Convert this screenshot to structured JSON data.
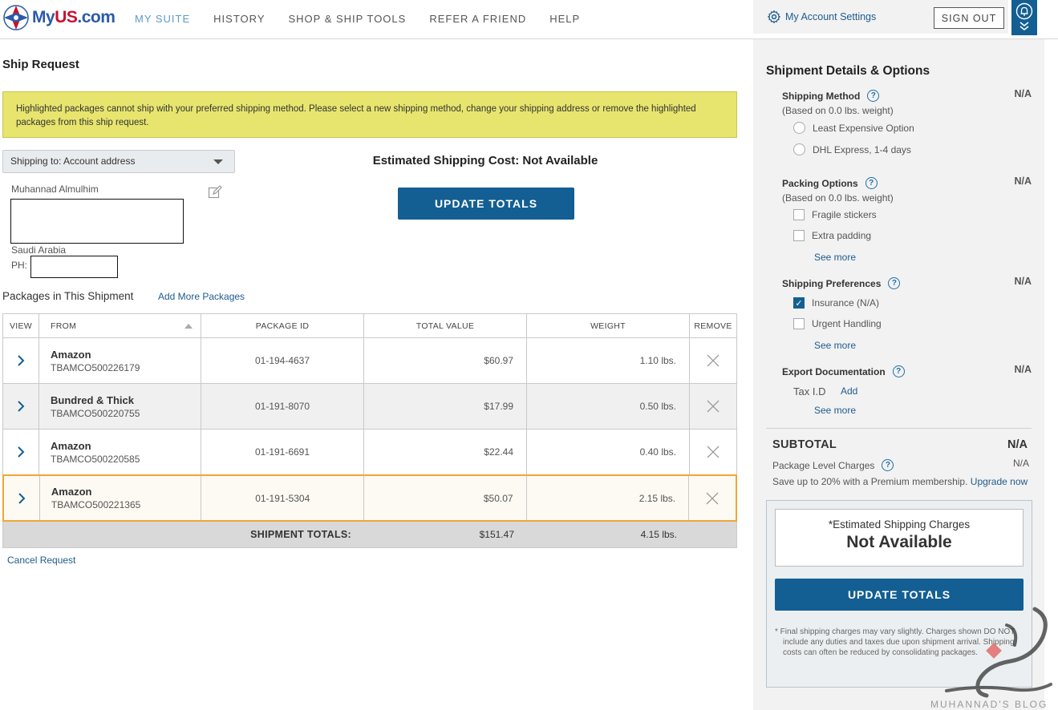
{
  "header": {
    "logo": {
      "part1": "My",
      "part2": "US",
      "part3": ".com"
    },
    "nav": [
      {
        "label": "MY SUITE",
        "active": true
      },
      {
        "label": "HISTORY",
        "active": false
      },
      {
        "label": "SHOP & SHIP TOOLS",
        "active": false
      },
      {
        "label": "REFER A FRIEND",
        "active": false
      },
      {
        "label": "HELP",
        "active": false
      }
    ],
    "account_settings": "My Account Settings",
    "sign_out": "SIGN OUT"
  },
  "main": {
    "title": "Ship Request",
    "alert": "Highlighted packages cannot ship with your preferred shipping method. Please select a new shipping method, change your shipping address or remove the highlighted packages from this ship request.",
    "shipping_to": "Shipping to: Account address",
    "address": {
      "name": "Muhannad Almulhim",
      "country": "Saudi Arabia",
      "phone_label": "PH:"
    },
    "estimated_cost": "Estimated Shipping Cost: Not Available",
    "update_totals": "UPDATE TOTALS",
    "packages_title": "Packages in This Shipment",
    "add_more": "Add More Packages",
    "cancel": "Cancel Request"
  },
  "table": {
    "headers": {
      "view": "VIEW",
      "from": "FROM",
      "package_id": "PACKAGE ID",
      "total_value": "TOTAL VALUE",
      "weight": "WEIGHT",
      "remove": "REMOVE"
    },
    "rows": [
      {
        "from": "Amazon",
        "code": "TBAMCO500226179",
        "package_id": "01-194-4637",
        "value": "$60.97",
        "weight": "1.10 lbs.",
        "highlighted": false
      },
      {
        "from": "Bundred & Thick",
        "code": "TBAMCO500220755",
        "package_id": "01-191-8070",
        "value": "$17.99",
        "weight": "0.50 lbs.",
        "highlighted": false
      },
      {
        "from": "Amazon",
        "code": "TBAMCO500220585",
        "package_id": "01-191-6691",
        "value": "$22.44",
        "weight": "0.40 lbs.",
        "highlighted": false
      },
      {
        "from": "Amazon",
        "code": "TBAMCO500221365",
        "package_id": "01-191-5304",
        "value": "$50.07",
        "weight": "2.15 lbs.",
        "highlighted": true
      }
    ],
    "totals": {
      "label": "SHIPMENT TOTALS:",
      "value": "$151.47",
      "weight": "4.15 lbs."
    }
  },
  "sidebar": {
    "title": "Shipment Details & Options",
    "shipping_method": {
      "label": "Shipping Method",
      "sub": "(Based on 0.0 lbs. weight)",
      "value": "N/A",
      "options": [
        "Least Expensive Option",
        "DHL Express, 1-4 days"
      ]
    },
    "packing_options": {
      "label": "Packing Options",
      "sub": "(Based on 0.0 lbs. weight)",
      "value": "N/A",
      "options": [
        "Fragile stickers",
        "Extra padding"
      ],
      "see_more": "See more"
    },
    "shipping_preferences": {
      "label": "Shipping Preferences",
      "value": "N/A",
      "options": [
        "Insurance (N/A)",
        "Urgent Handling"
      ],
      "see_more": "See more"
    },
    "export_documentation": {
      "label": "Export Documentation",
      "value": "N/A",
      "tax_id": "Tax I.D",
      "add": "Add",
      "see_more": "See more"
    },
    "subtotal": {
      "label": "SUBTOTAL",
      "value": "N/A"
    },
    "package_level_charges": {
      "label": "Package Level Charges",
      "value": "N/A"
    },
    "premium": {
      "text": "Save up to 20% with a Premium membership.",
      "link": "Upgrade now"
    },
    "estimated": {
      "label": "*Estimated Shipping Charges",
      "value": "Not Available"
    },
    "update_totals": "UPDATE TOTALS",
    "fine_print": "* Final shipping charges may vary slightly. Charges shown DO NOT include any duties and taxes due upon shipment arrival. Shipping costs can often be reduced by consolidating packages."
  },
  "watermark": {
    "text": "MUHANNAD'S BLOG"
  },
  "colors": {
    "brand": "#135f93",
    "alert": "#e7e56e",
    "highlight_border": "#f0a637",
    "link": "#1e5b8f"
  }
}
